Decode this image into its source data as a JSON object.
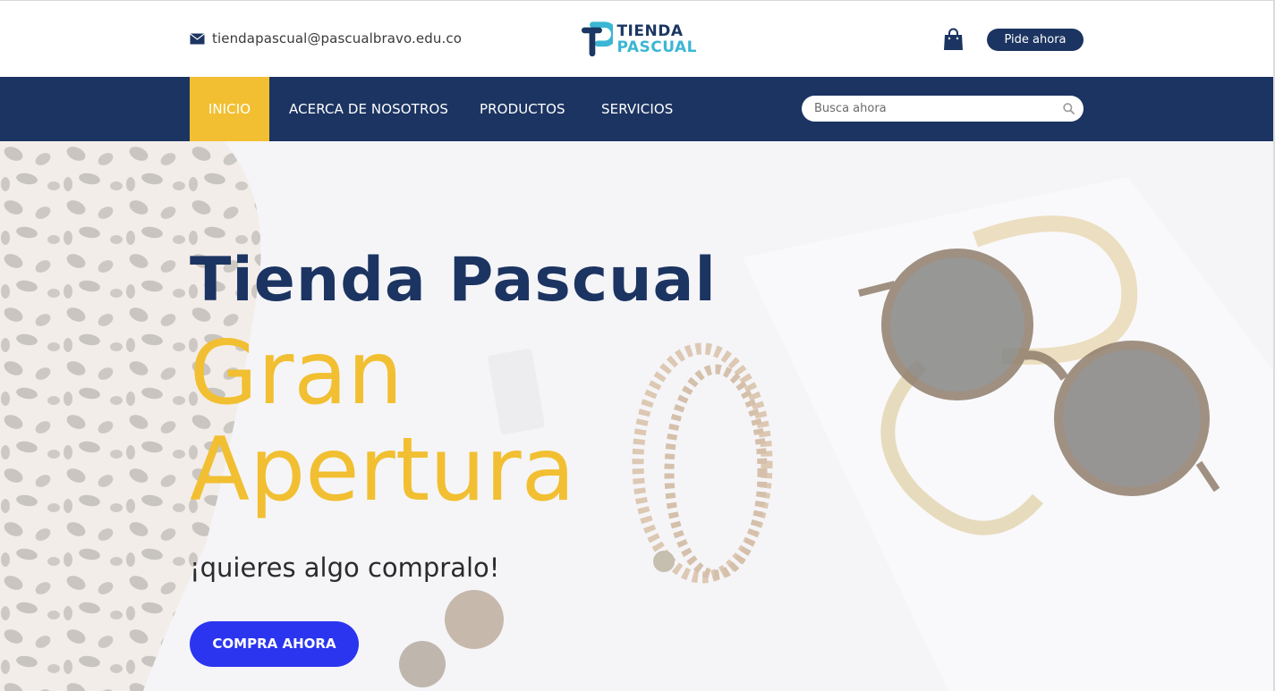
{
  "header": {
    "email": "tiendapascual@pascualbravo.edu.co",
    "logo_line1": "TIENDA",
    "logo_line2": "PASCUAL",
    "order_button": "Pide ahora"
  },
  "nav": {
    "items": [
      {
        "label": "INICIO",
        "active": true
      },
      {
        "label": "ACERCA DE NOSOTROS",
        "active": false
      },
      {
        "label": "PRODUCTOS",
        "active": false
      },
      {
        "label": "SERVICIOS",
        "active": false
      }
    ],
    "search_placeholder": "Busca ahora"
  },
  "hero": {
    "title": "Tienda Pascual",
    "headline_1": "Gran",
    "headline_2": "Apertura",
    "subtitle": "¡quieres algo compralo!",
    "cta": "COMPRA AHORA"
  },
  "icons": {
    "email": "envelope-icon",
    "cart": "shopping-bag-icon",
    "search": "magnifier-icon"
  },
  "colors": {
    "navy": "#1c3461",
    "yellow": "#f1bf31",
    "cta_blue": "#2b35f0",
    "logo_teal": "#3bb6d4"
  }
}
